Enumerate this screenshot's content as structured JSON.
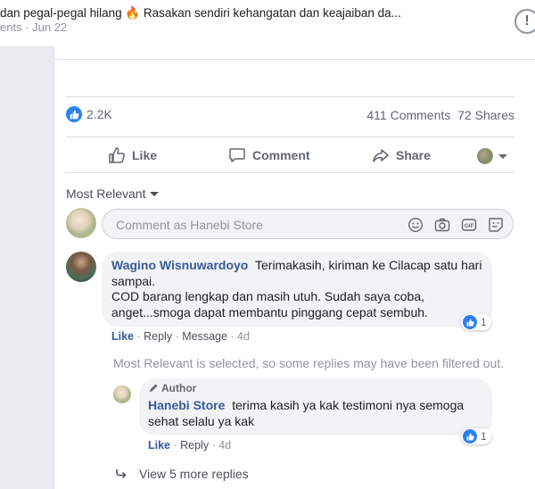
{
  "post": {
    "text": "dan pegal-pegal hilang 🔥 Rasakan sendiri kehangatan dan keajaiban da...",
    "meta": "ents · Jun 22",
    "alert_icon": "!"
  },
  "stats": {
    "reaction_count": "2.2K",
    "comments": "411 Comments",
    "shares": "72 Shares"
  },
  "actions": {
    "like": "Like",
    "comment": "Comment",
    "share": "Share"
  },
  "sort_label": "Most Relevant",
  "comment_input": {
    "placeholder": "Comment as Hanebi Store"
  },
  "comments": [
    {
      "author": "Wagino Wisnuwardoyo",
      "text": "Terimakasih, kiriman ke Cilacap satu hari sampai.",
      "text2": "COD barang lengkap dan masih utuh. Sudah saya coba, anget...smoga dapat membantu pinggang cepat sembuh.",
      "reactions": "1",
      "like": "Like",
      "reply": "Reply",
      "message": "Message",
      "time": "4d"
    }
  ],
  "filter_notice": "Most Relevant is selected, so some replies may have been filtered out.",
  "reply": {
    "badge": "Author",
    "author": "Hanebi Store",
    "text": "terima kasih ya kak testimoni nya semoga sehat selalu ya kak",
    "reactions": "1",
    "like": "Like",
    "reply": "Reply",
    "time": "4d"
  },
  "more_replies": "View 5 more replies",
  "colors": {
    "link": "#385898",
    "like_blue": "#2e81f4",
    "bubble": "#f2f3f5"
  }
}
